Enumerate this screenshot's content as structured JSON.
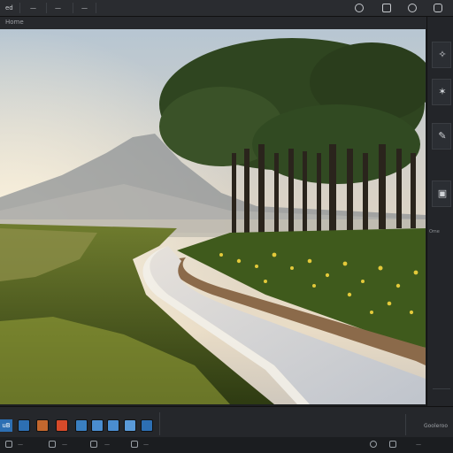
{
  "menu": {
    "items": [
      {
        "label": "ed"
      },
      {
        "label": "—"
      },
      {
        "label": "—"
      },
      {
        "label": "—"
      }
    ],
    "right_icons": [
      "refresh-icon",
      "settings-icon",
      "contrast-icon",
      "camera-icon"
    ]
  },
  "document": {
    "title": "Home"
  },
  "canvas": {
    "image_description_icon": "landscape-image"
  },
  "right_panel": {
    "tools": [
      {
        "icon": "figure-icon",
        "glyph": "✧"
      },
      {
        "icon": "adjust-icon",
        "glyph": "✶"
      },
      {
        "icon": "brush-icon",
        "glyph": "✎"
      },
      {
        "icon": "layer-icon",
        "glyph": "▣"
      }
    ],
    "note": "Ome"
  },
  "filmstrip": {
    "label": "uB",
    "thumbnail_colors": [
      "#2d6fb3",
      "#3a7fc0",
      "#c3672e",
      "#d64a2a",
      "#3a7fc0",
      "#4a8dd0",
      "#4a8dd0",
      "#5a9ad8",
      "#2d6fb3"
    ],
    "right_text": "Gooleroo"
  },
  "status": {
    "items": [
      "—",
      "—",
      "—",
      "—"
    ],
    "right_text": "—"
  },
  "colors": {
    "chrome_bg": "#1d1f22",
    "panel_bg": "#232529",
    "accent": "#2d6fb3"
  }
}
